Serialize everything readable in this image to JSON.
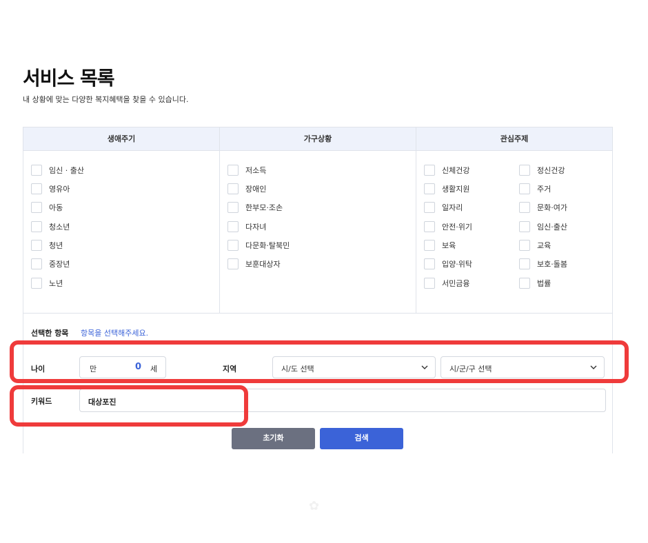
{
  "header": {
    "title": "서비스 목록",
    "subtitle": "내 상황에 맞는 다양한 복지혜택을 찾을 수 있습니다."
  },
  "columns": {
    "life": "생애주기",
    "household": "가구상황",
    "interest": "관심주제"
  },
  "life_items": [
    "임신 · 출산",
    "영유아",
    "아동",
    "청소년",
    "청년",
    "중장년",
    "노년"
  ],
  "household_items": [
    "저소득",
    "장애인",
    "한부모·조손",
    "다자녀",
    "다문화·탈북민",
    "보훈대상자"
  ],
  "interest_left": [
    "신체건강",
    "생활지원",
    "일자리",
    "안전·위기",
    "보육",
    "입양·위탁",
    "서민금융"
  ],
  "interest_right": [
    "정신건강",
    "주거",
    "문화·여가",
    "임신·출산",
    "교육",
    "보호·돌봄",
    "법률"
  ],
  "selected": {
    "label": "선택한 항목",
    "placeholder": "항목을 선택해주세요."
  },
  "age": {
    "label": "나이",
    "prefix": "만",
    "value": "0",
    "suffix": "세"
  },
  "region": {
    "label": "지역",
    "sido": "시/도 선택",
    "sigungu": "시/군/구 선택"
  },
  "keyword": {
    "label": "키워드",
    "value": "대상포진"
  },
  "buttons": {
    "reset": "초기화",
    "search": "검색"
  },
  "colors": {
    "accent": "#3b63d8",
    "reset_button": "#6b7080",
    "highlight": "#ef3b3b",
    "header_bg": "#eef2fb"
  }
}
